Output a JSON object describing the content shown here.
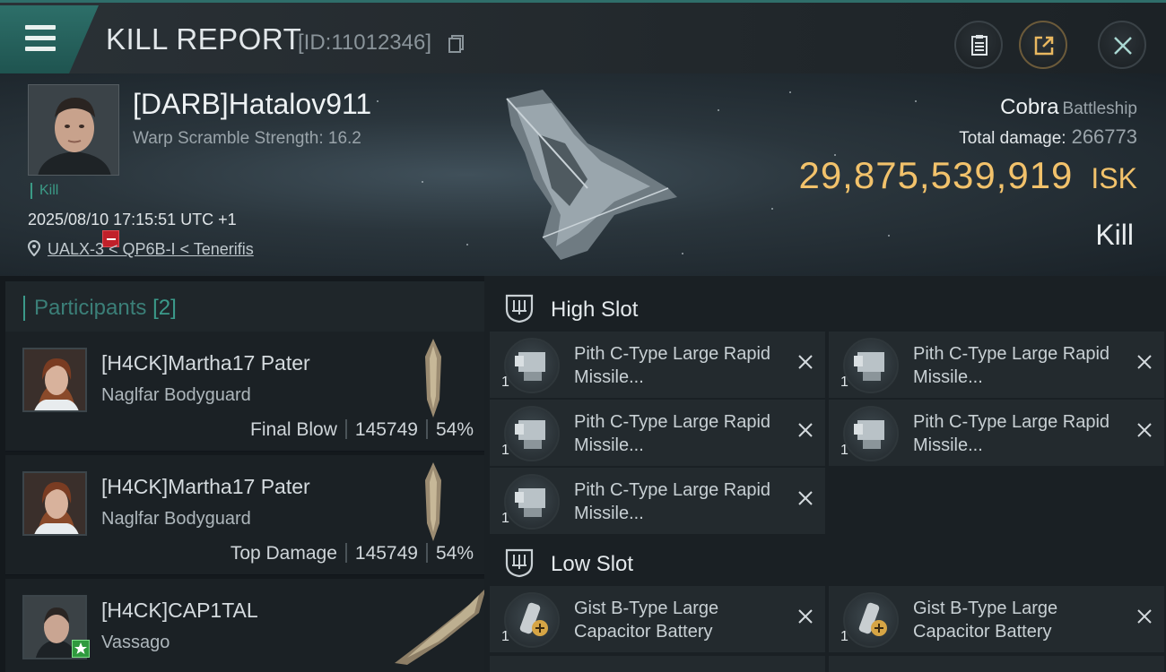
{
  "header": {
    "title": "KILL REPORT",
    "report_id": "[ID:11012346]"
  },
  "victim": {
    "name": "[DARB]Hatalov911",
    "warp_scramble": "Warp Scramble Strength: 16.2",
    "tag": "Kill",
    "datetime": "2025/08/10 17:15:51 UTC +1",
    "location": "UALX-3 < QP6B-I < Tenerifis",
    "ship_name": "Cobra",
    "ship_class": "Battleship",
    "total_damage_label": "Total damage:",
    "total_damage": "266773",
    "isk_value": "29,875,539,919",
    "isk_unit": "ISK",
    "result": "Kill"
  },
  "participants": {
    "label": "Participants",
    "count": "[2]",
    "items": [
      {
        "name": "[H4CK]Martha17 Pater",
        "ship": "Naglfar Bodyguard",
        "role": "Final Blow",
        "damage": "145749",
        "percent": "54%"
      },
      {
        "name": "[H4CK]Martha17 Pater",
        "ship": "Naglfar Bodyguard",
        "role": "Top Damage",
        "damage": "145749",
        "percent": "54%"
      },
      {
        "name": "[H4CK]CAP1TAL",
        "ship": "Vassago"
      }
    ]
  },
  "modules": {
    "high_slot_label": "High Slot",
    "low_slot_label": "Low Slot",
    "high": [
      {
        "name": "Pith C-Type Large Rapid Missile...",
        "qty": "1"
      },
      {
        "name": "Pith C-Type Large Rapid Missile...",
        "qty": "1"
      },
      {
        "name": "Pith C-Type Large Rapid Missile...",
        "qty": "1"
      },
      {
        "name": "Pith C-Type Large Rapid Missile...",
        "qty": "1"
      },
      {
        "name": "Pith C-Type Large Rapid Missile...",
        "qty": "1"
      }
    ],
    "low": [
      {
        "name": "Gist B-Type Large Capacitor Battery",
        "qty": "1"
      },
      {
        "name": "Gist B-Type Large Capacitor Battery",
        "qty": "1"
      }
    ]
  },
  "icons": {
    "menu": "hamburger-icon",
    "copy": "copy-icon",
    "clipboard": "clipboard-icon",
    "share": "share-icon",
    "close": "close-icon",
    "location": "location-pin-icon",
    "slot": "slot-shield-icon",
    "remove": "x-icon"
  },
  "colors": {
    "accent_teal": "#2f6e6a",
    "isk_gold": "#f2c26b",
    "negative_badge": "#c1202a",
    "star_badge": "#2f9a3e"
  }
}
